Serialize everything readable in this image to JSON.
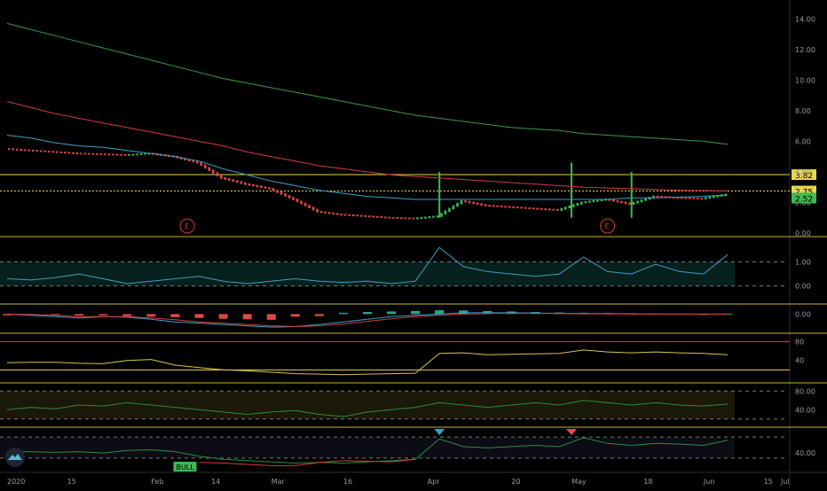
{
  "chart_data": {
    "type": "candlestick",
    "x_ticks": [
      "2020",
      "15",
      "Feb",
      "14",
      "Mar",
      "16",
      "Apr",
      "20",
      "May",
      "18",
      "Jun",
      "15",
      "Jul"
    ],
    "x_domain": [
      0,
      30
    ],
    "x_tick_positions": [
      0,
      2.5,
      6,
      8.5,
      11,
      14,
      17.5,
      21,
      23.5,
      26.5,
      29,
      31.5,
      35
    ],
    "panels": [
      {
        "id": "price",
        "y_range": [
          0,
          15
        ],
        "y_ticks": [
          "14.00",
          "12.00",
          "10.00",
          "8.00",
          "6.00",
          "4.00",
          "2.00",
          "0.00"
        ],
        "y_tick_values": [
          14,
          12,
          10,
          8,
          6,
          4,
          2,
          0
        ],
        "horizontal_levels": [
          {
            "value": 3.82,
            "label": "3.82",
            "color": "#e8d44d"
          },
          {
            "value": 2.75,
            "label": "2.75",
            "color": "#e8d44d"
          }
        ],
        "last_price": {
          "value": 2.52,
          "label": "2.52",
          "color": "#3fb950"
        },
        "earnings_markers": [
          {
            "x": 7.5,
            "label": "E"
          },
          {
            "x": 25,
            "label": "E"
          }
        ],
        "close": [
          5.5,
          5.4,
          5.3,
          5.2,
          5.15,
          5.1,
          5.2,
          5.0,
          4.6,
          3.6,
          3.2,
          2.9,
          2.2,
          1.4,
          1.2,
          1.1,
          1.0,
          0.95,
          1.1,
          2.1,
          1.8,
          1.7,
          1.6,
          1.5,
          2.0,
          2.2,
          1.9,
          2.4,
          2.3,
          2.25,
          2.52
        ],
        "series": [
          {
            "name": "",
            "color": "#3aa0c8",
            "values": [
              6.4,
              6.2,
              5.9,
              5.7,
              5.6,
              5.4,
              5.2,
              5.0,
              4.7,
              4.2,
              3.8,
              3.4,
              3.1,
              2.8,
              2.6,
              2.4,
              2.3,
              2.2,
              2.2,
              2.2,
              2.2,
              2.2,
              2.2,
              2.2,
              2.2,
              2.2,
              2.3,
              2.3,
              2.35,
              2.4,
              2.5
            ]
          },
          {
            "name": "",
            "color": "#d43c3c",
            "values": [
              8.6,
              8.2,
              7.8,
              7.5,
              7.2,
              6.9,
              6.6,
              6.3,
              6.0,
              5.7,
              5.3,
              5.0,
              4.7,
              4.4,
              4.2,
              4.0,
              3.8,
              3.7,
              3.6,
              3.5,
              3.4,
              3.3,
              3.2,
              3.1,
              3.0,
              2.95,
              2.9,
              2.85,
              2.8,
              2.78,
              2.75
            ]
          },
          {
            "name": "",
            "color": "#3a9a4a",
            "values": [
              13.7,
              13.3,
              12.9,
              12.5,
              12.1,
              11.7,
              11.3,
              10.9,
              10.5,
              10.1,
              9.8,
              9.5,
              9.2,
              8.9,
              8.6,
              8.3,
              8.0,
              7.7,
              7.5,
              7.3,
              7.1,
              6.9,
              6.8,
              6.7,
              6.5,
              6.4,
              6.3,
              6.2,
              6.1,
              6.0,
              5.8
            ]
          }
        ]
      },
      {
        "id": "oscillator-1",
        "y_range": [
          -0.6,
          1.9
        ],
        "y_ticks": [
          "1.00",
          "0.00"
        ],
        "y_tick_values": [
          1,
          0
        ],
        "dashed_levels": [
          1,
          0
        ],
        "series": [
          {
            "name": "",
            "color": "#3aa0c8",
            "values": [
              0.3,
              0.25,
              0.35,
              0.5,
              0.3,
              0.1,
              0.2,
              0.3,
              0.4,
              0.2,
              0.1,
              0.2,
              0.3,
              0.2,
              0.15,
              0.2,
              0.1,
              0.2,
              1.6,
              0.8,
              0.6,
              0.5,
              0.4,
              0.5,
              1.2,
              0.6,
              0.5,
              0.9,
              0.6,
              0.5,
              1.3
            ]
          }
        ]
      },
      {
        "id": "histogram",
        "y_range": [
          -0.6,
          0.25
        ],
        "y_ticks": [
          "0.00"
        ],
        "y_tick_values": [
          0
        ],
        "histogram": [
          -0.05,
          -0.05,
          -0.05,
          -0.06,
          -0.05,
          -0.08,
          -0.1,
          -0.12,
          -0.15,
          -0.18,
          -0.2,
          -0.22,
          -0.1,
          -0.08,
          0.05,
          0.08,
          0.1,
          0.12,
          0.15,
          0.14,
          0.12,
          0.1,
          0.08,
          0.06,
          0.05,
          0.04,
          0.03,
          0.02,
          0.01,
          0.0,
          0.01
        ],
        "series": [
          {
            "name": "",
            "color": "#3aa0c8",
            "values": [
              0.0,
              -0.05,
              -0.1,
              -0.15,
              -0.1,
              -0.12,
              -0.2,
              -0.3,
              -0.35,
              -0.4,
              -0.45,
              -0.5,
              -0.48,
              -0.4,
              -0.3,
              -0.2,
              -0.1,
              -0.05,
              0.0,
              0.05,
              0.05,
              0.05,
              0.04,
              0.03,
              0.02,
              0.02,
              0.01,
              0.0,
              0.0,
              0.0,
              0.0
            ]
          },
          {
            "name": "",
            "color": "#d43c3c",
            "values": [
              0.0,
              -0.02,
              -0.05,
              -0.1,
              -0.1,
              -0.1,
              -0.15,
              -0.22,
              -0.3,
              -0.35,
              -0.4,
              -0.45,
              -0.48,
              -0.45,
              -0.38,
              -0.28,
              -0.18,
              -0.1,
              -0.05,
              0.0,
              0.02,
              0.03,
              0.03,
              0.02,
              0.01,
              0.01,
              0.0,
              0.0,
              0.0,
              0.0,
              0.0
            ]
          }
        ]
      },
      {
        "id": "oscillator-2",
        "y_range": [
          0,
          90
        ],
        "y_ticks": [
          "80",
          "40"
        ],
        "y_tick_values": [
          80,
          40
        ],
        "horizontal_levels": [
          {
            "value": 80,
            "color": "#d43c3c"
          },
          {
            "value": 20,
            "color": "#e8d44d"
          }
        ],
        "series": [
          {
            "name": "",
            "color": "#d4c64a",
            "values": [
              35,
              36,
              36,
              34,
              33,
              40,
              42,
              30,
              25,
              20,
              18,
              15,
              12,
              11,
              10,
              11,
              12,
              13,
              55,
              56,
              52,
              53,
              54,
              55,
              62,
              58,
              56,
              58,
              56,
              55,
              52
            ]
          }
        ]
      },
      {
        "id": "oscillator-3",
        "y_range": [
          10,
          90
        ],
        "y_ticks": [
          "80.00",
          "40.00"
        ],
        "y_tick_values": [
          80,
          40
        ],
        "dashed_levels": [
          80,
          20
        ],
        "series": [
          {
            "name": "",
            "color": "#2e8b3e",
            "values": [
              40,
              45,
              42,
              50,
              48,
              55,
              50,
              45,
              40,
              35,
              30,
              35,
              38,
              30,
              25,
              35,
              40,
              45,
              55,
              50,
              45,
              50,
              55,
              50,
              60,
              55,
              50,
              55,
              50,
              48,
              52
            ]
          }
        ]
      },
      {
        "id": "oscillator-4",
        "y_range": [
          15,
          75
        ],
        "y_ticks": [
          "40.00"
        ],
        "y_tick_values": [
          40
        ],
        "dashed_levels": [
          65,
          32
        ],
        "triangle_markers": [
          {
            "x": 18,
            "color": "#3aa0c8"
          },
          {
            "x": 23.5,
            "color": "#e8484d"
          }
        ],
        "bull_label": {
          "x": 7,
          "text": "BULL"
        },
        "series": [
          {
            "name": "",
            "color": "#2e8b3e",
            "values": [
              42,
              42,
              41,
              42,
              40,
              44,
              45,
              42,
              35,
              30,
              28,
              26,
              24,
              25,
              24,
              26,
              28,
              30,
              62,
              50,
              48,
              50,
              52,
              50,
              64,
              55,
              52,
              55,
              54,
              52,
              60
            ]
          },
          {
            "name": "",
            "color": "#d43c3c",
            "values": [
              null,
              null,
              null,
              null,
              null,
              null,
              null,
              null,
              25,
              24,
              22,
              20,
              20,
              25,
              28,
              27,
              26,
              30,
              null,
              null,
              null,
              null,
              null,
              null,
              null,
              null,
              null,
              null,
              null,
              null,
              null
            ]
          }
        ]
      }
    ]
  }
}
